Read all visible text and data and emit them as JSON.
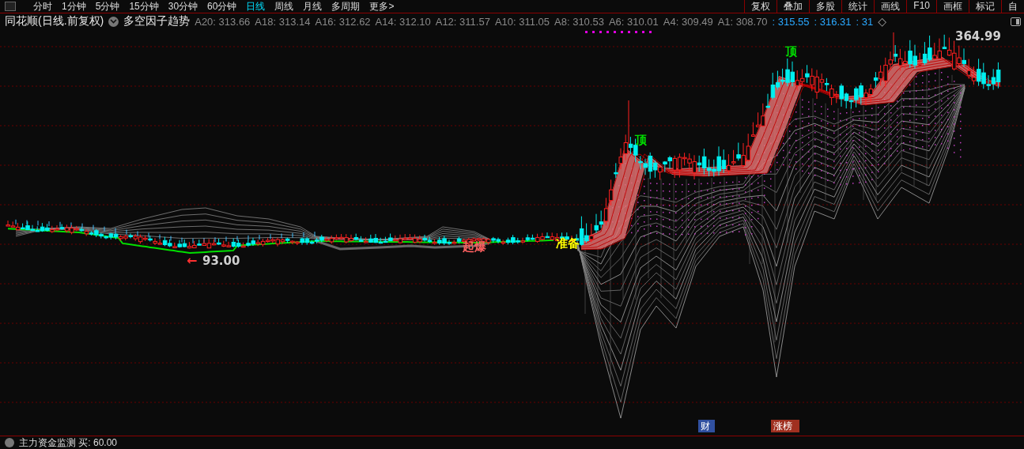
{
  "toolbar": {
    "periods": [
      {
        "label": "分时",
        "selected": false
      },
      {
        "label": "1分钟",
        "selected": false
      },
      {
        "label": "5分钟",
        "selected": false
      },
      {
        "label": "15分钟",
        "selected": false
      },
      {
        "label": "30分钟",
        "selected": false
      },
      {
        "label": "60分钟",
        "selected": false
      },
      {
        "label": "日线",
        "selected": true
      },
      {
        "label": "周线",
        "selected": false
      },
      {
        "label": "月线",
        "selected": false
      },
      {
        "label": "多周期",
        "selected": false
      },
      {
        "label": "更多>",
        "selected": false
      }
    ],
    "tools": [
      "复权",
      "叠加",
      "多股",
      "统计",
      "画线",
      "F10",
      "画框",
      "标记",
      "自"
    ]
  },
  "info_bar": {
    "stock": "同花顺(日线.前复权)",
    "indicator": "多空因子趋势",
    "values": [
      {
        "label": "A20:",
        "value": "313.66"
      },
      {
        "label": "A18:",
        "value": "313.14"
      },
      {
        "label": "A16:",
        "value": "312.62"
      },
      {
        "label": "A14:",
        "value": "312.10"
      },
      {
        "label": "A12:",
        "value": "311.57"
      },
      {
        "label": "A10:",
        "value": "311.05"
      },
      {
        "label": "A8:",
        "value": "310.53"
      },
      {
        "label": "A6:",
        "value": "310.01"
      },
      {
        "label": "A4:",
        "value": "309.49"
      },
      {
        "label": "A1:",
        "value": "308.70"
      }
    ],
    "readings": [
      ": 315.55",
      ": 316.31",
      ": 31"
    ],
    "marker": "◇"
  },
  "chart": {
    "annotations": [
      {
        "text": "←",
        "kind": "arrow",
        "color": "#ff3030"
      },
      {
        "text": "93.00",
        "kind": "price",
        "color": "#d0d0d0"
      },
      {
        "text": "起爆",
        "kind": "signal",
        "color": "#ff6060"
      },
      {
        "text": "准备",
        "kind": "signal",
        "color": "#ffff00"
      },
      {
        "text": "顶",
        "kind": "top",
        "color": "#00e000"
      },
      {
        "text": "顶",
        "kind": "top",
        "color": "#00e000"
      },
      {
        "text": "364.99",
        "kind": "price",
        "color": "#d0d0d0"
      }
    ],
    "events": [
      {
        "text": "财",
        "color": "#3050a0"
      },
      {
        "text": "涨榜",
        "color": "#a03020"
      }
    ]
  },
  "bottom_panel": {
    "title": "主力资金监测 买: 60.00"
  }
}
